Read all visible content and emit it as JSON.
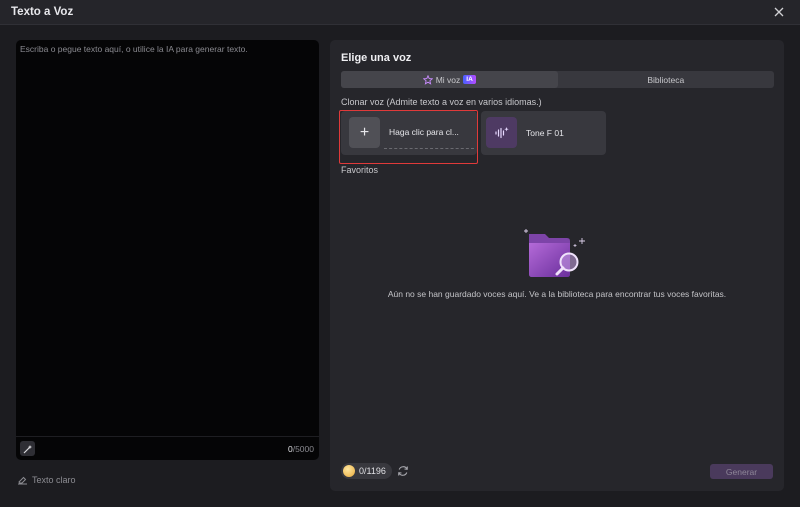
{
  "window": {
    "title": "Texto a Voz"
  },
  "editor": {
    "placeholder": "Escriba o pegue texto aquí, o utilice la IA para generar texto.",
    "char_count": "0",
    "char_limit": "/5000",
    "clear_label": "Texto claro"
  },
  "panel": {
    "title": "Elige una voz",
    "tabs": [
      {
        "label": "Mi voz",
        "badge": "IA",
        "active": true
      },
      {
        "label": "Biblioteca",
        "active": false
      }
    ],
    "clone_section_label": "Clonar voz (Admite texto a voz en varios idiomas.)",
    "clone_card_label": "Haga clic para cl...",
    "voices": [
      {
        "name": "Tone  F 01"
      }
    ],
    "favorites_label": "Favoritos",
    "empty_message": "Aún no se han guardado voces aquí. Ve a la biblioteca para encontrar tus voces favoritas.",
    "credits": "0/1196",
    "generate_label": "Generar"
  },
  "colors": {
    "accent_purple": "#7a4fb0",
    "highlight_red": "#e03a3a"
  }
}
